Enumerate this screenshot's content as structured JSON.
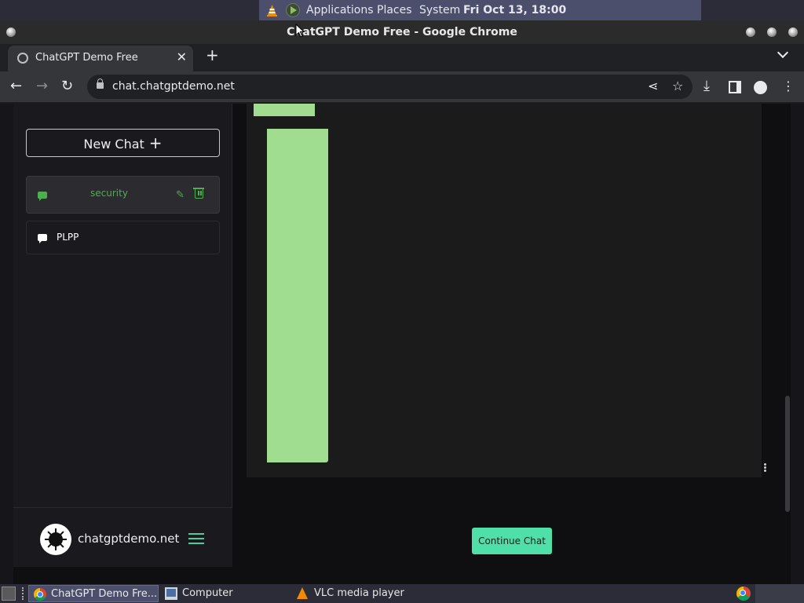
{
  "top_panel": {
    "menus": [
      "Applications",
      "Places",
      "System"
    ],
    "clock": "Fri Oct 13, 18:00"
  },
  "window": {
    "title": "ChatGPT Demo Free - Google Chrome"
  },
  "browser": {
    "tab_title": "ChatGPT Demo Free",
    "url": "chat.chatgptdemo.net"
  },
  "sidebar": {
    "new_chat_label": "New Chat",
    "chats": [
      {
        "label": "security",
        "active": true
      },
      {
        "label": "PLPP",
        "active": false
      }
    ],
    "brand_name": "chatgptdemo.net"
  },
  "main": {
    "continue_label": "Continue Chat"
  },
  "taskbar": {
    "tasks": [
      "ChatGPT Demo Fre...",
      "Computer",
      "VLC media player"
    ]
  },
  "colors": {
    "accent": "#4ee0a8",
    "active_chat": "#4caf50",
    "message_block": "#a1dd90"
  }
}
